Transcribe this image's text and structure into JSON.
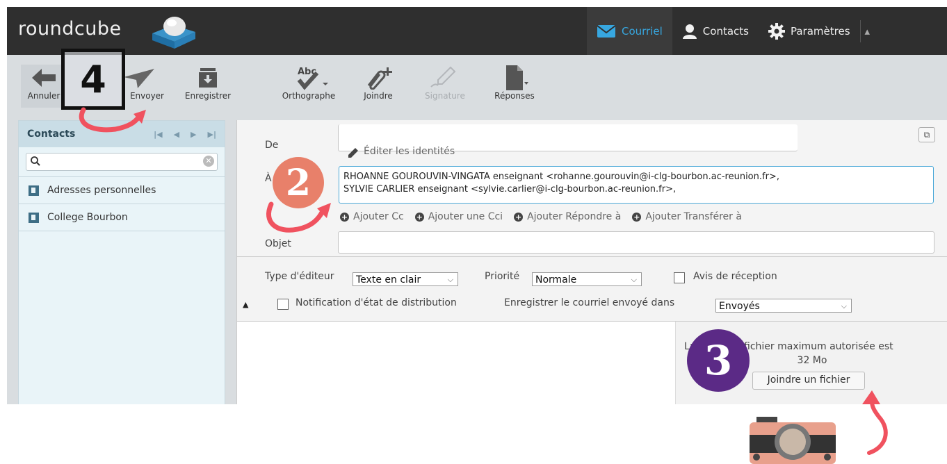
{
  "app": {
    "logo_text": "roundcube"
  },
  "nav": {
    "mail": "Courriel",
    "contacts": "Contacts",
    "settings": "Paramètres"
  },
  "toolbar": {
    "cancel": "Annuler",
    "send": "Envoyer",
    "save": "Enregistrer",
    "spell": "Orthographe",
    "attach": "Joindre",
    "signature": "Signature",
    "responses": "Réponses",
    "spell_icon_text": "Abc"
  },
  "contacts_panel": {
    "title": "Contacts",
    "items": [
      {
        "label": "Adresses personnelles"
      },
      {
        "label": "College Bourbon"
      }
    ]
  },
  "compose": {
    "from_label": "De",
    "edit_identities": "Éditer les identités",
    "to_label": "À",
    "recipients_line1": "RHOANNE GOUROUVIN-VINGATA enseignant <rohanne.gourouvin@i-clg-bourbon.ac-reunion.fr>,",
    "recipients_line2": "SYLVIE CARLIER enseignant <sylvie.carlier@i-clg-bourbon.ac-reunion.fr>,",
    "add_cc": "Ajouter Cc",
    "add_bcc": "Ajouter une Cci",
    "add_reply_to": "Ajouter Répondre à",
    "add_followup_to": "Ajouter Transférer à",
    "subject_label": "Objet"
  },
  "options": {
    "editor_type_label": "Type d'éditeur",
    "editor_type_value": "Texte en clair",
    "priority_label": "Priorité",
    "priority_value": "Normale",
    "return_receipt": "Avis de réception",
    "dsn": "Notification d'état de distribution",
    "save_sent_label": "Enregistrer le courriel envoyé dans",
    "save_sent_value": "Envoyés"
  },
  "attachments": {
    "size_line1_start": "La",
    "size_line1_end": "fichier maximum autorisée est",
    "size_line2": "32 Mo",
    "button": "Joindre un fichier"
  },
  "annotations": {
    "step4": "4",
    "step2": "2",
    "step3": "3"
  },
  "colors": {
    "topbar": "#2f2f2f",
    "accent": "#37a7e0",
    "arrow": "#f0525f",
    "badge2": "#e8806a",
    "badge3": "#5b2a86"
  }
}
